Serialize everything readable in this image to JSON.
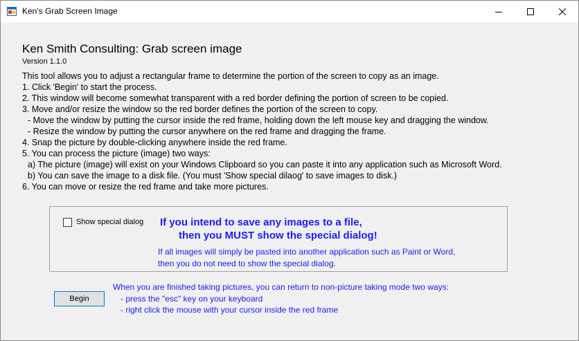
{
  "window": {
    "title": "Ken's Grab Screen Image"
  },
  "header": {
    "title": "Ken Smith Consulting: Grab screen image",
    "version": "Version 1.1.0"
  },
  "instructions": [
    "This tool allows you to adjust a rectangular frame to determine the portion of the screen to copy as an image.",
    "1. Click 'Begin' to start the process.",
    "2. This window will become somewhat transparent with a red border defining the portion of screen to be copied.",
    "3. Move and/or resize the window so the red border defines the portion of the screen to copy.",
    "   - Move the window by putting the cursor inside the red frame, holding down the left mouse key and dragging the window.",
    "   - Resize the window by putting the cursor anywhere on the red frame and dragging the frame.",
    "4. Snap the picture by double-clicking anywhere inside the red frame.",
    "5. You can process the picture (image) two ways:",
    "   a) The picture (image) will exist on your Windows Clipboard so you can paste it into any application such as Microsoft Word.",
    "   b) You can save the image to a disk file. (You must 'Show special dilaog' to save images to disk.)",
    "6. You can move or resize the red frame and take more pictures."
  ],
  "dialog_option": {
    "checkbox_label": "Show special dialog",
    "checked": false,
    "warning_line1": "If you intend to save any images to a file,",
    "warning_line2": "then you MUST show the special dialog!",
    "note_line1": "If all images will simply be pasted into another application such as Paint or Word,",
    "note_line2": "then you do not need to show the special dialog."
  },
  "begin_button": {
    "label": "Begin"
  },
  "finish_info": {
    "line1": "When you are finished taking pictures, you can return to non-picture taking mode two ways:",
    "line2": "- press the \"esc\" key on your keyboard",
    "line3": "- right click the mouse with your cursor inside the red frame"
  },
  "colors": {
    "accent_text": "#1a1aff",
    "window_bg": "#f0f0f0"
  },
  "icons": {
    "app": "app-window-icon",
    "minimize": "minimize-icon",
    "maximize": "maximize-icon",
    "close": "close-icon"
  }
}
